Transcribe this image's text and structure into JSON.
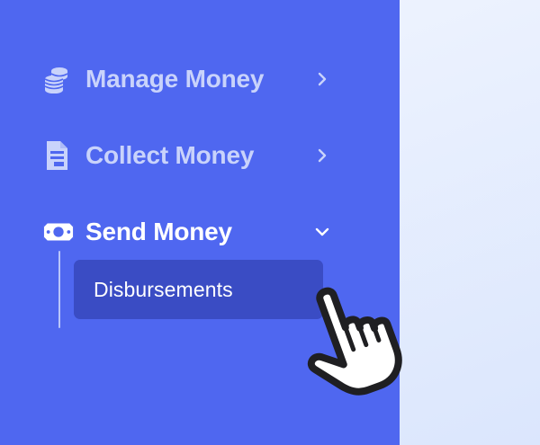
{
  "sidebar": {
    "items": [
      {
        "label": "Manage Money",
        "icon": "coins-stack-icon",
        "state": "collapsed"
      },
      {
        "label": "Collect Money",
        "icon": "invoice-document-icon",
        "state": "collapsed"
      },
      {
        "label": "Send Money",
        "icon": "banknote-icon",
        "state": "expanded",
        "children": [
          {
            "label": "Disbursements",
            "selected": true
          }
        ]
      }
    ]
  },
  "colors": {
    "sidebar_bg": "#4f67f0",
    "inactive_text": "#c9d3fb",
    "active_text": "#ffffff",
    "subitem_bg": "#3a4cc4",
    "content_bg": "#e4ecfd"
  },
  "cursor": {
    "icon": "hand-pointer-icon"
  }
}
